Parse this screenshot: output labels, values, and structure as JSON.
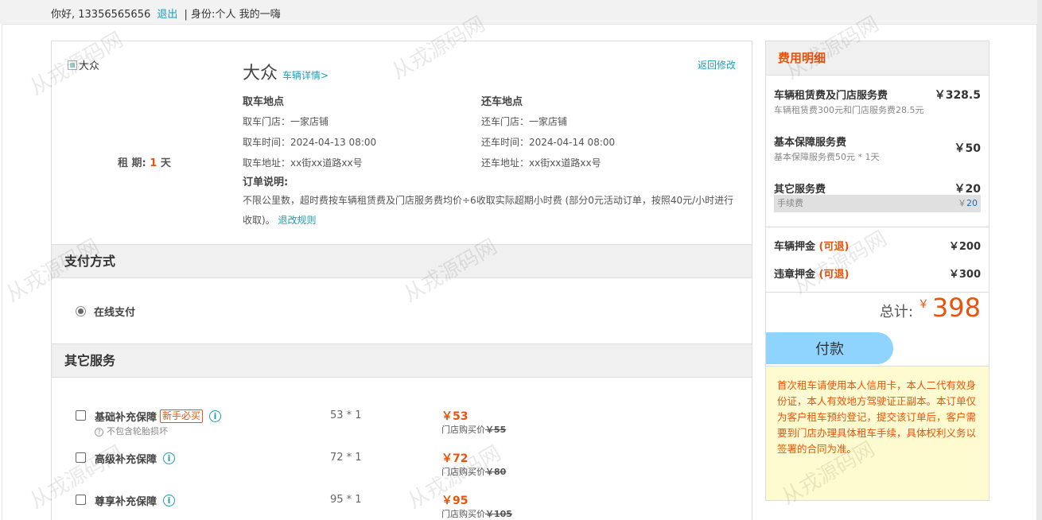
{
  "topbar": {
    "greeting": "你好, 13356565656",
    "logout": "退出",
    "identity": "| 身份:个人  我的一嗨"
  },
  "order": {
    "car_image_alt": "大众",
    "rental_period_label": "租 期:",
    "rental_period_days": "1",
    "rental_period_unit": "天",
    "car_name": "大众",
    "car_detail_link": "车辆详情>",
    "back_link": "返回修改",
    "pickup": {
      "title": "取车地点",
      "store": "取车门店：一家店铺",
      "time": "取车时间：2024-04-13 08:00",
      "address": "取车地址：xx街xx道路xx号"
    },
    "return": {
      "title": "还车地点",
      "store": "还车门店：一家店铺",
      "time": "还车时间：2024-04-14 08:00",
      "address": "还车地址：xx街xx道路xx号"
    },
    "note_title": "订单说明:",
    "note_text": "不限公里数，超时费按车辆租赁费及门店服务费均价÷6收取实际超期小时费 (部分0元活动订单，按照40元/小时进行收取)。",
    "note_link": "退改规则"
  },
  "payment": {
    "title": "支付方式",
    "option": "在线支付"
  },
  "services": {
    "title": "其它服务",
    "items": [
      {
        "name": "基础补充保障",
        "badge": "新手必买",
        "sub": "不包含轮胎损坏",
        "qty": "53 * 1",
        "price": "￥53",
        "store_label": "门店购买价",
        "store_price": "￥55"
      },
      {
        "name": "高级补充保障",
        "qty": "72 * 1",
        "price": "￥72",
        "store_label": "门店购买价",
        "store_price": "￥80"
      },
      {
        "name": "尊享补充保障",
        "qty": "95 * 1",
        "price": "￥95",
        "store_label": "门店购买价",
        "store_price": "￥105"
      }
    ]
  },
  "fee": {
    "title": "费用明细",
    "rent_title": "车辆租赁费及门店服务费",
    "rent_value": "￥328.5",
    "rent_desc": "车辆租赁费300元和门店服务费28.5元",
    "basic_title": "基本保障服务费",
    "basic_value": "￥50",
    "basic_desc": "基本保障服务费50元 * 1天",
    "other_title": "其它服务费",
    "other_value": "￥20",
    "handling_label": "手续费",
    "handling_currency": "￥",
    "handling_value": "20",
    "deposit_title": "车辆押金",
    "deposit_note": "(可退)",
    "deposit_value": "￥200",
    "violation_title": "违章押金",
    "violation_note": "(可退)",
    "violation_value": "￥300",
    "total_label": "总计:",
    "total_currency": "￥",
    "total_value": "398",
    "pay_button": "付款",
    "notice": "首次租车请使用本人信用卡，本人二代有效身份证，本人有效地方驾驶证正副本。本订单仅为客户租车预约登记，提交该订单后，客户需要到门店办理具体租车手续，具体权利义务以签署的合同为准。"
  },
  "watermark": "从戎源码网",
  "colors": {
    "accent": "#e8540c",
    "link": "#1aa0b8",
    "button": "#8fd3ff",
    "notice_bg": "#fffbd0"
  }
}
